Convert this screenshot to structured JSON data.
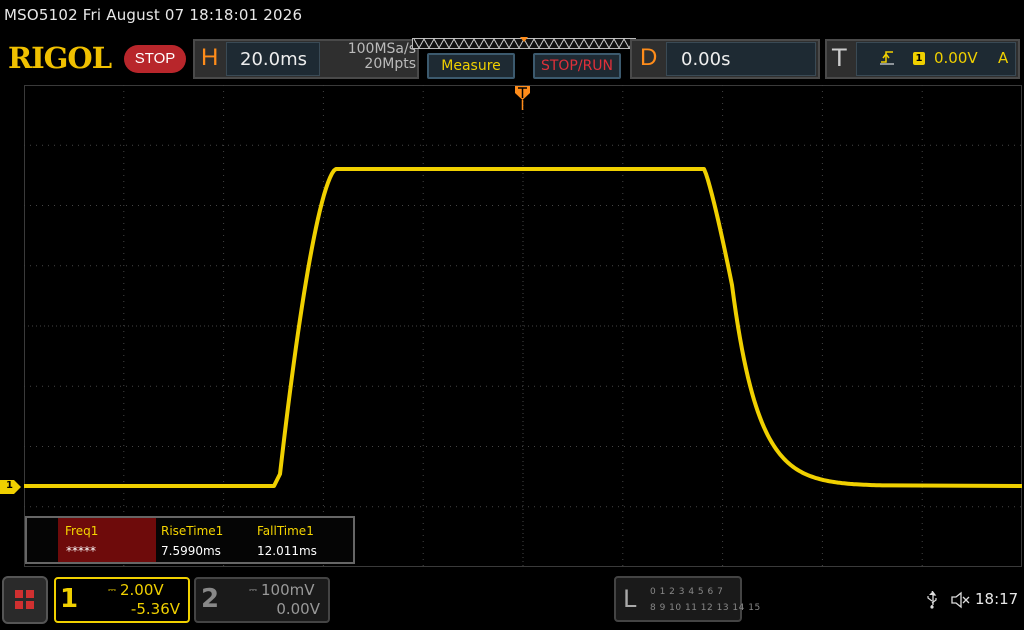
{
  "window": {
    "title": "MSO5102  Fri August 07 18:18:01 2026"
  },
  "brand": {
    "logo": "RIGOL",
    "run_state": "STOP"
  },
  "horizontal": {
    "tag": "H",
    "timebase": "20.0ms",
    "sample_rate": "100MSa/s",
    "memory_depth": "20Mpts"
  },
  "buttons": {
    "measure": "Measure",
    "stop_run": "STOP/RUN"
  },
  "delay": {
    "tag": "D",
    "value": "0.00s"
  },
  "trigger": {
    "tag": "T",
    "source": "1",
    "level": "0.00V",
    "mode": "A"
  },
  "markers": {
    "ch1": "1"
  },
  "measurements": [
    {
      "name": "Freq1",
      "value": "*****"
    },
    {
      "name": "RiseTime1",
      "value": "7.5990ms"
    },
    {
      "name": "FallTime1",
      "value": "12.011ms"
    }
  ],
  "channels": [
    {
      "number": "1",
      "scale": "2.00V",
      "offset": "-5.36V",
      "active": true
    },
    {
      "number": "2",
      "scale": "100mV",
      "offset": "0.00V",
      "active": false
    }
  ],
  "logic": {
    "tag": "L",
    "row1": "0 1 2 3  4 5 6 7",
    "row2": "8 9 10 11 12 13 14 15"
  },
  "status": {
    "time": "18:17"
  },
  "colors": {
    "ch1": "#f0d000",
    "grid": "#444444",
    "stop": "#b8262b",
    "accent": "#ff8c1a"
  },
  "icons": [
    "usb-icon",
    "speaker-muted-icon",
    "menu-grid-icon",
    "trigger-rising-edge-icon"
  ]
}
